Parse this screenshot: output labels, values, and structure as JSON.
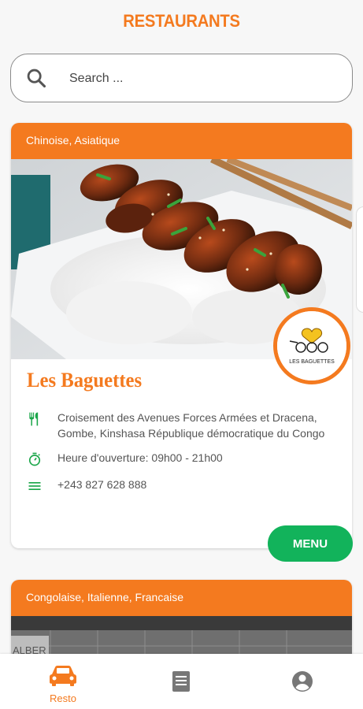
{
  "header": {
    "title": "RESTAURANTS"
  },
  "search": {
    "placeholder": "Search ..."
  },
  "restaurants": [
    {
      "categories": "Chinoise, Asiatique",
      "name": "Les Baguettes",
      "logo_text": "LES BAGUETTES",
      "address": "Croisement des Avenues Forces Armées et Dracena, Gombe, Kinshasa République démocratique du Congo",
      "hours": "Heure d'ouverture: 09h00 - 21h00",
      "phone": "+243 827 628 888",
      "menu_label": "MENU"
    },
    {
      "categories": "Congolaise, Italienne, Francaise",
      "image_text": "ALBER"
    }
  ],
  "bottom_nav": {
    "items": [
      {
        "label": "Resto",
        "icon": "car-icon",
        "active": true
      },
      {
        "label": "",
        "icon": "list-icon",
        "active": false
      },
      {
        "label": "",
        "icon": "account-icon",
        "active": false
      }
    ]
  },
  "colors": {
    "accent": "#f47a1f",
    "green": "#12b35b",
    "icon_green": "#1ba64a",
    "inactive": "#777777"
  }
}
